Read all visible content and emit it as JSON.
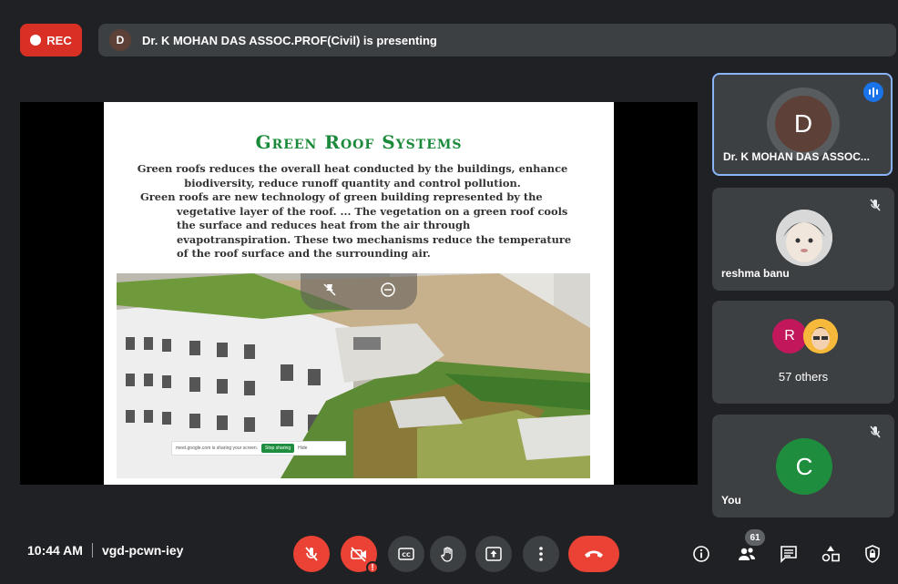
{
  "recording": {
    "label": "REC"
  },
  "presenting": {
    "avatar_initial": "D",
    "text": "Dr. K MOHAN DAS ASSOC.PROF(Civil) is presenting"
  },
  "slide": {
    "title": "Green Roof Systems",
    "para1": "Green roofs reduces the overall heat conducted by the buildings, enhance biodiversity, reduce runoff quantity and control pollution.",
    "para2": "Green roofs are new technology of green building represented by the vegetative layer of the roof. ... The vegetation on a green roof cools the surface and reduces heat from the air through evapotranspiration. These two mechanisms reduce the temperature of the roof surface and the surrounding air."
  },
  "share_toast": {
    "text": "meet.google.com is sharing your screen.",
    "stop_label": "Stop sharing",
    "hide_label": "Hide"
  },
  "participants": [
    {
      "name": "Dr. K MOHAN DAS ASSOC...",
      "initial": "D",
      "color": "#5d4037",
      "speaking": true
    },
    {
      "name": "reshma banu",
      "muted": true
    },
    {
      "name": "57 others",
      "initials": [
        "R"
      ],
      "color": "#c2185b"
    },
    {
      "name": "You",
      "initial": "C",
      "color": "#1e8e3e",
      "muted": true
    }
  ],
  "meeting": {
    "time": "10:44 AM",
    "code": "vgd-pcwn-iey"
  },
  "controls": {
    "participant_count": "61"
  },
  "colors": {
    "accent_blue": "#1a73e8",
    "end_red": "#ea4335",
    "slide_title_green": "#1a8a3a"
  }
}
